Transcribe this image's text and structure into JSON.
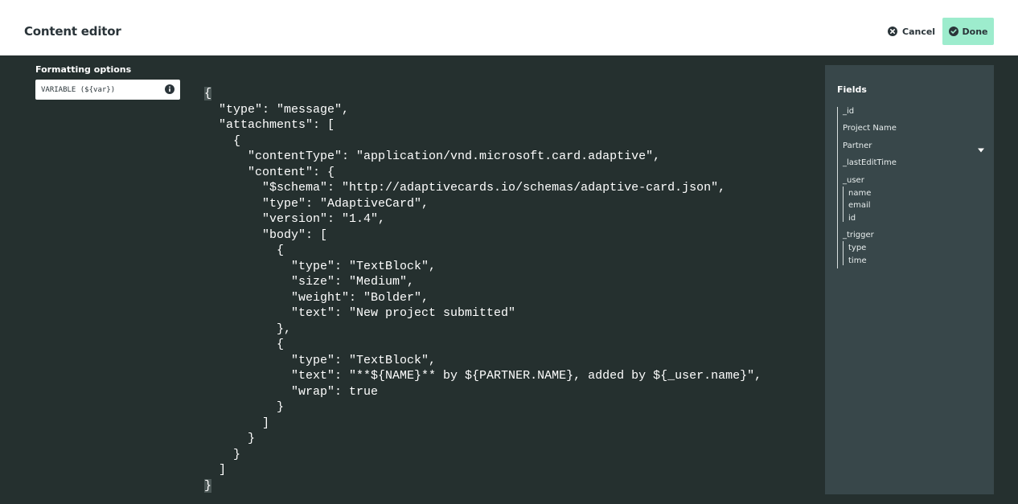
{
  "header": {
    "title": "Content editor",
    "cancel_label": "Cancel",
    "done_label": "Done"
  },
  "formatting": {
    "label": "Formatting options",
    "selected": "VARIABLE (${var})"
  },
  "code_lines": [
    "{",
    "  \"type\": \"message\",",
    "  \"attachments\": [",
    "    {",
    "      \"contentType\": \"application/vnd.microsoft.card.adaptive\",",
    "      \"content\": {",
    "        \"$schema\": \"http://adaptivecards.io/schemas/adaptive-card.json\",",
    "        \"type\": \"AdaptiveCard\",",
    "        \"version\": \"1.4\",",
    "        \"body\": [",
    "          {",
    "            \"type\": \"TextBlock\",",
    "            \"size\": \"Medium\",",
    "            \"weight\": \"Bolder\",",
    "            \"text\": \"New project submitted\"",
    "          },",
    "          {",
    "            \"type\": \"TextBlock\",",
    "            \"text\": \"**${NAME}** by ${PARTNER.NAME}, added by ${_user.name}\",",
    "            \"wrap\": true",
    "          }",
    "        ]",
    "      }",
    "    }",
    "  ]",
    "}"
  ],
  "fields": {
    "title": "Fields",
    "items": [
      {
        "label": "_id"
      },
      {
        "label": "Project Name"
      },
      {
        "label": "Partner"
      },
      {
        "label": "_lastEditTime"
      },
      {
        "label": "_user",
        "children": [
          "name",
          "email",
          "id"
        ]
      },
      {
        "label": "_trigger",
        "children": [
          "type",
          "time"
        ]
      }
    ]
  },
  "colors": {
    "editor_bg": "#25302f",
    "panel_bg": "#38474a",
    "done_bg": "#9deccd"
  }
}
